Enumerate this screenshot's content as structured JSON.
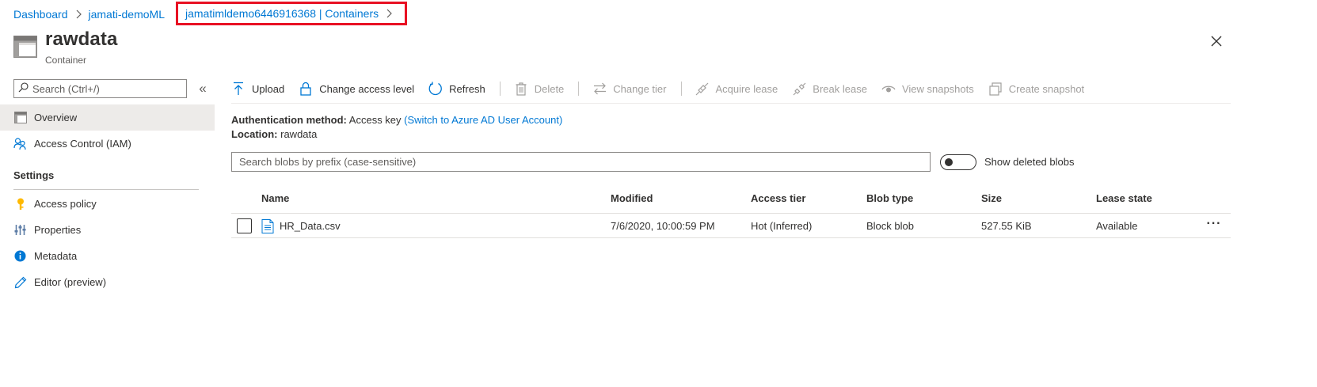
{
  "breadcrumb": {
    "items": [
      "Dashboard",
      "jamati-demoML",
      "jamatimldemo6446916368 | Containers"
    ]
  },
  "header": {
    "title": "rawdata",
    "subtitle": "Container"
  },
  "sidebar": {
    "search_placeholder": "Search (Ctrl+/)",
    "items": [
      {
        "label": "Overview",
        "icon": "container-icon",
        "selected": true
      },
      {
        "label": "Access Control (IAM)",
        "icon": "people-icon",
        "selected": false
      }
    ],
    "settings_title": "Settings",
    "settings_items": [
      {
        "label": "Access policy",
        "icon": "key-icon"
      },
      {
        "label": "Properties",
        "icon": "sliders-icon"
      },
      {
        "label": "Metadata",
        "icon": "info-icon"
      },
      {
        "label": "Editor (preview)",
        "icon": "pencil-icon"
      }
    ]
  },
  "toolbar": {
    "upload": "Upload",
    "change_access_level": "Change access level",
    "refresh": "Refresh",
    "delete": "Delete",
    "change_tier": "Change tier",
    "acquire_lease": "Acquire lease",
    "break_lease": "Break lease",
    "view_snapshots": "View snapshots",
    "create_snapshot": "Create snapshot"
  },
  "info": {
    "auth_label": "Authentication method:",
    "auth_value": "Access key",
    "auth_link": "(Switch to Azure AD User Account)",
    "location_label": "Location:",
    "location_value": "rawdata"
  },
  "blob_search": {
    "placeholder": "Search blobs by prefix (case-sensitive)"
  },
  "show_deleted": {
    "label": "Show deleted blobs",
    "on": false
  },
  "table": {
    "columns": [
      "Name",
      "Modified",
      "Access tier",
      "Blob type",
      "Size",
      "Lease state"
    ],
    "rows": [
      {
        "name": "HR_Data.csv",
        "modified": "7/6/2020, 10:00:59 PM",
        "access_tier": "Hot (Inferred)",
        "blob_type": "Block blob",
        "size": "527.55 KiB",
        "lease_state": "Available"
      }
    ],
    "more_label": "···"
  },
  "colors": {
    "accent": "#0078d4",
    "highlight_box": "#e81123",
    "selected_nav": "#edebe9"
  }
}
